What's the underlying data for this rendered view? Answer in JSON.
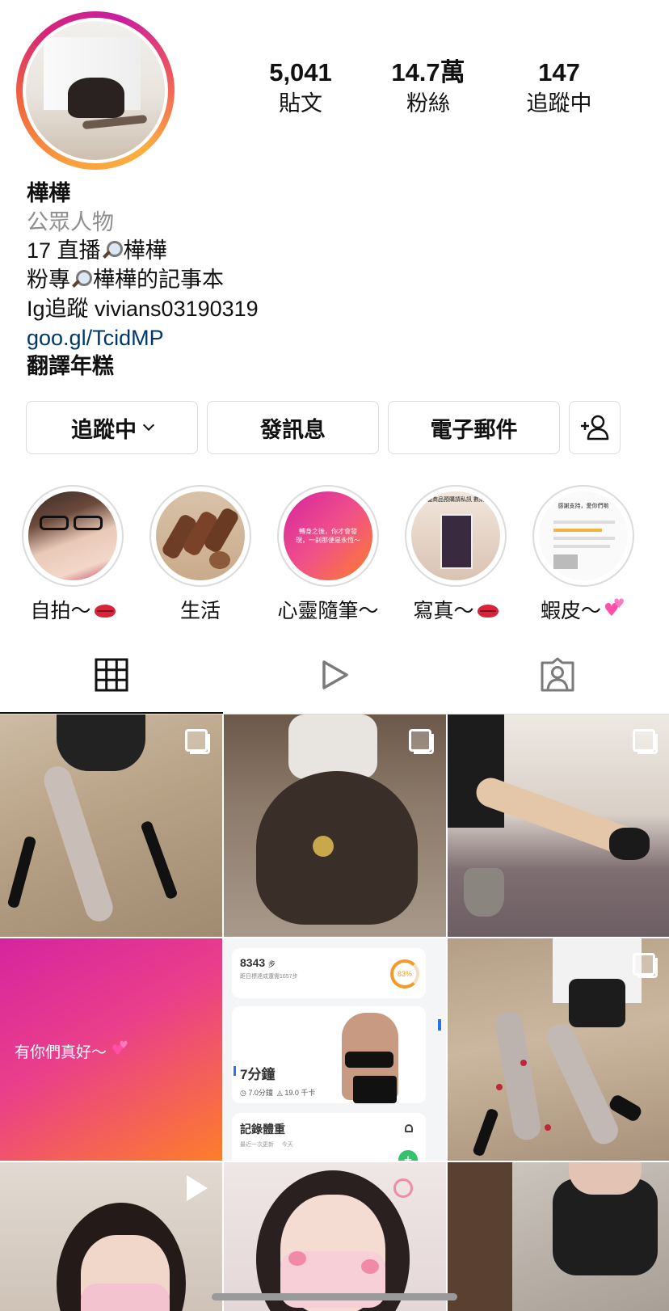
{
  "profile": {
    "stats": [
      {
        "value": "5,041",
        "label": "貼文"
      },
      {
        "value": "14.7萬",
        "label": "粉絲"
      },
      {
        "value": "147",
        "label": "追蹤中"
      }
    ],
    "name": "樺樺",
    "category": "公眾人物",
    "bio_line1": "17 直播",
    "bio_line1_tail": "樺樺",
    "bio_line2": "粉專",
    "bio_line2_tail": "樺樺的記事本",
    "bio_line3": "Ig追蹤 vivians03190319",
    "link": "goo.gl/TcidMP",
    "extra": "翻譯年糕"
  },
  "actions": {
    "following_label": "追蹤中",
    "message_label": "發訊息",
    "email_label": "電子郵件"
  },
  "highlights": [
    {
      "label": "自拍～"
    },
    {
      "label": "生活"
    },
    {
      "label": "心靈隨筆～",
      "cover_text": "轉身之後，你才會發現，一刹那便是永恆～"
    },
    {
      "label": "寫真～",
      "cover_text": "周邊商品預購請私訊 數購買"
    },
    {
      "label": "蝦皮～",
      "cover_text": "感謝支持，愛你們喲"
    }
  ],
  "grid": {
    "quote_post": "有你們真好～",
    "fitness": {
      "steps": "8343",
      "steps_unit": "步",
      "steps_sub": "距日標達成還需1657步",
      "percent": "83%",
      "workout": "7分鐘",
      "duration": "7.0分鐘",
      "calories": "19.0 千卡",
      "weight_title": "記錄體重",
      "weight_sub_left": "最近一次更新",
      "weight_sub_right": "今天"
    }
  },
  "colors": {
    "accent_gradient_start": "#d6249f",
    "accent_gradient_end": "#fd7e2a",
    "link": "#00376b",
    "border": "#dbdbdb"
  }
}
